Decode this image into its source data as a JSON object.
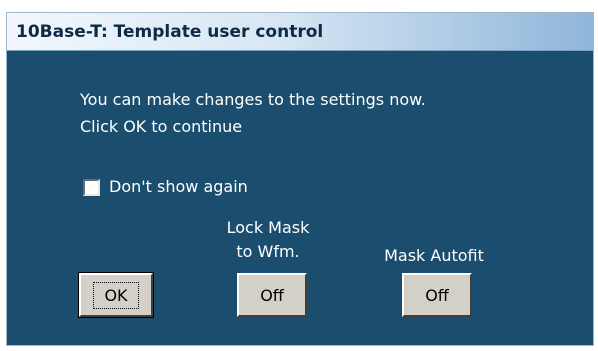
{
  "dialog": {
    "title": "10Base-T: Template user control",
    "message_line1": "You can make changes to the settings now.",
    "message_line2": "Click OK to continue",
    "dont_show_again": {
      "label": "Don't show again",
      "checked": false
    },
    "ok_button": {
      "label": "OK"
    },
    "lock_mask": {
      "label_line1": "Lock Mask",
      "label_line2": "to Wfm.",
      "value": "Off"
    },
    "mask_autofit": {
      "label": "Mask Autofit",
      "value": "Off"
    }
  },
  "colors": {
    "dialog_background": "#1b4d6e",
    "title_text": "#0e2a47",
    "button_face": "#d4d0c8"
  }
}
